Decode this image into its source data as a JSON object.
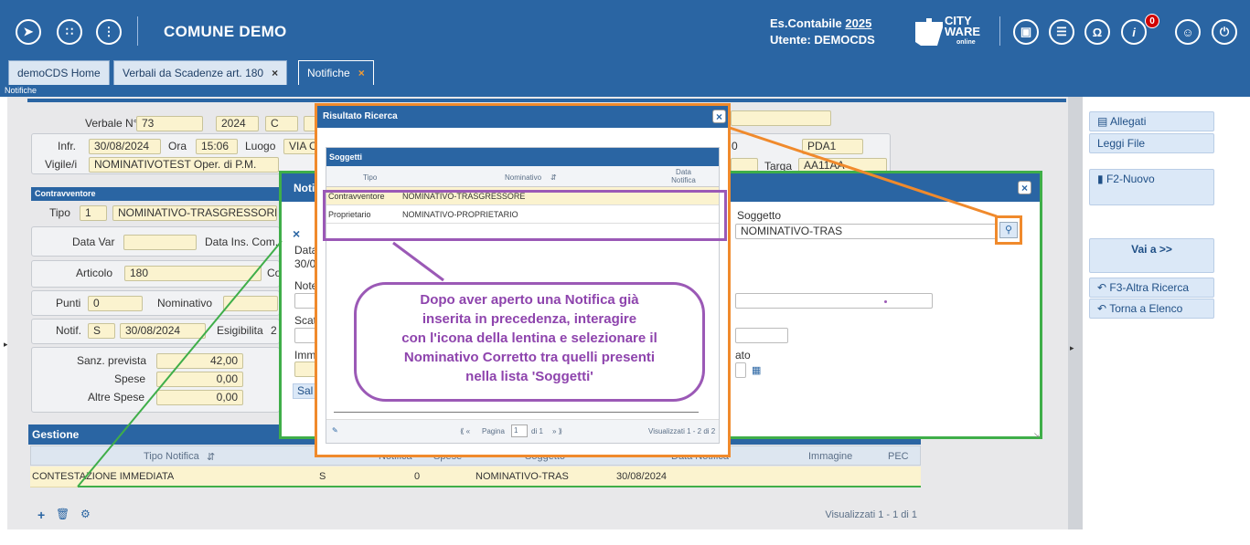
{
  "app": {
    "name": "COMUNE DEMO",
    "eserc_label": "Es.Contabile",
    "eserc_year": "2025",
    "user_line": "Utente: DEMOCDS",
    "logo_line1": "CITY",
    "logo_line2": "WARE",
    "logo_sub": "online",
    "notifications_count": "0"
  },
  "tabs": [
    {
      "label": "demoCDS Home"
    },
    {
      "label": "Verbali da Scadenze art. 180",
      "close": "×"
    },
    {
      "label": "Notifiche",
      "close": "×"
    }
  ],
  "breadcrumb": "Notifiche",
  "verbale": {
    "label": "Verbale N°",
    "numero": "73",
    "anno": "2024",
    "tipo": "C",
    "infr_label": "Infr.",
    "infr_data": "30/08/2024",
    "ora_label": "Ora",
    "ora": "15:06",
    "luogo_label": "Luogo",
    "luogo": "VIA C.",
    "vigile_label": "Vigile/i",
    "vigile": "NOMINATIVOTEST Oper. di P.M.",
    "pda": "PDA1",
    "targa_label": "Targa",
    "targa": "AA11AA",
    "zero": "0"
  },
  "contravventore": {
    "header": "Contravventore",
    "tipo_label": "Tipo",
    "tipo": "1",
    "nome": "NOMINATIVO-TRASGRESSORE",
    "data_var_label": "Data Var",
    "data_ins_label": "Data Ins. Com.",
    "articolo_label": "Articolo",
    "articolo": "180",
    "co": "Co",
    "punti_label": "Punti",
    "punti": "0",
    "nominativo_label": "Nominativo",
    "notif_label": "Notif.",
    "notif": "S",
    "notif_data": "30/08/2024",
    "esigibilita_label": "Esigibilita",
    "esig_val": "2",
    "sanz_label": "Sanz. prevista",
    "sanz": "42,00",
    "spese_label": "Spese",
    "spese": "0,00",
    "altre_label": "Altre Spese",
    "altre": "0,00"
  },
  "gestione": {
    "title": "Gestione",
    "columns": [
      "Tipo Notifica",
      "Notifica",
      "Spese",
      "Soggetto",
      "Data Notifica",
      "Immagine",
      "PEC"
    ],
    "row": [
      "CONTESTAZIONE IMMEDIATA",
      "S",
      "0",
      "NOMINATIVO-TRAS",
      "30/08/2024",
      "",
      ""
    ],
    "footer": "Visualizzati 1 - 1 di 1"
  },
  "sidebar": {
    "allegati": "Allegati",
    "leggi": "Leggi File",
    "nuovo": "F2-Nuovo",
    "vai": "Vai a >>",
    "altra": "F3-Altra Ricerca",
    "torna": "Torna a Elenco"
  },
  "notifica_dialog": {
    "title": "Noti",
    "soggetto_label": "Soggetto",
    "soggetto": "NOMINATIVO-TRAS",
    "data_label": "Data",
    "data_val": "30/0",
    "note_label": "Note",
    "scat_label": "Scat",
    "imm_label": "Imm",
    "ato_label": "ato",
    "save_label": "Sal"
  },
  "risultato": {
    "title": "Risultato Ricerca",
    "soggetti_header": "Soggetti",
    "columns": [
      "Tipo",
      "Nominativo",
      "Data Notifica"
    ],
    "rows": [
      {
        "tipo": "Contravventore",
        "nominativo": "NOMINATIVO-TRASGRESSORE"
      },
      {
        "tipo": "Proprietario",
        "nominativo": "NOMINATIVO-PROPRIETARIO"
      }
    ],
    "pager_label": "Pagina",
    "page": "1",
    "pager_of": "di 1",
    "visualizzati": "Visualizzati 1 - 2 di 2"
  },
  "annotation": {
    "line1": "Dopo aver aperto una Notifica già",
    "line2": "inserita in precedenza, interagire",
    "line3": "con l'icona della lentina e selezionare il",
    "line4": "Nominativo Corretto tra quelli presenti",
    "line5": "nella lista 'Soggetti'"
  },
  "colors": {
    "brand": "#2a65a3",
    "highlight_orange": "#f08a2c",
    "highlight_green": "#3fae49",
    "highlight_purple": "#9b59b6"
  }
}
